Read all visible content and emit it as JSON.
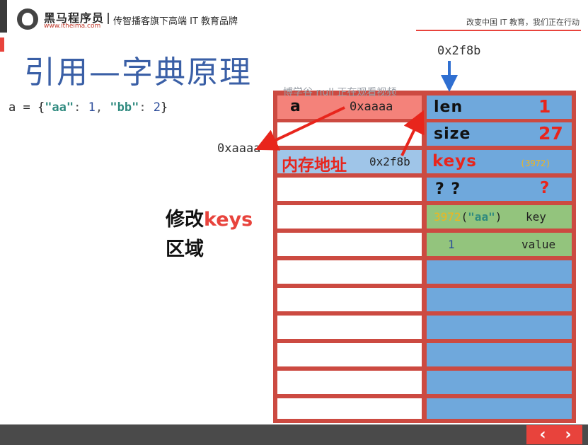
{
  "header": {
    "brand_name": "黑马程序员",
    "brand_url": "www.itheima.com",
    "tagline": "传智播客旗下高端 IT 教育品牌",
    "slogan": "改变中国 IT 教育，我们正在行动"
  },
  "title": "引用—字典原理",
  "watermark": "博学谷 null 正在观看视频",
  "code": {
    "prefix": "a = {",
    "key1": "\"aa\"",
    "sep1": ": ",
    "val1": "1",
    "comma": ", ",
    "key2": "\"bb\"",
    "sep2": ": ",
    "val2": "2",
    "suffix": "}"
  },
  "labels": {
    "top_address": "0x2f8b",
    "left_address": "0xaaaa"
  },
  "side_note": {
    "line1_prefix": "修改",
    "line1_keyword": "keys",
    "line2": "区域"
  },
  "memory": {
    "left": {
      "row0_name": "a",
      "row0_value": "0xaaaa",
      "row2_label": "内存地址",
      "row2_value": "0x2f8b"
    },
    "right": {
      "len_label": "len",
      "len_value": "1",
      "size_label": "size",
      "size_value": "27",
      "keys_label": "keys",
      "keys_value": "(3972)",
      "unknown_label": "? ?",
      "unknown_value": "?",
      "key_hash": "3972",
      "key_open": "(",
      "key_str": "\"aa\"",
      "key_close": ")",
      "key_label": "key",
      "value_num": "1",
      "value_label": "value"
    }
  },
  "colors": {
    "accent_red": "#e8433c",
    "title_blue": "#3a5fa6",
    "cell_blue": "#6fa8dc",
    "cell_green": "#93c47d",
    "arrow_blue": "#2f6fd1"
  },
  "nav": {
    "prev": "‹",
    "next": "›"
  }
}
